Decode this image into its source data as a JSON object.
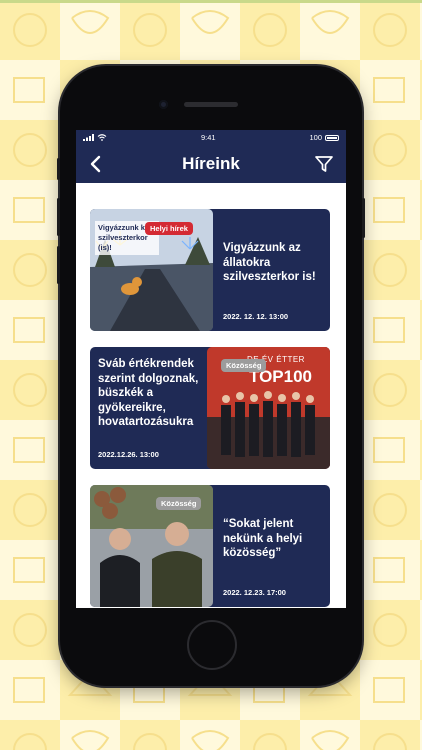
{
  "status_bar": {
    "time": "9:41",
    "battery": "100"
  },
  "header": {
    "title": "Híreink"
  },
  "news": [
    {
      "title": "Vigyázzunk az állatokra szilveszterkor is!",
      "date": "2022. 12. 12. 13:00",
      "category": "Helyi hírek",
      "image_caption": "Vigyázzunk k szilveszterkor (is)!"
    },
    {
      "title": "Sváb értékrendek szerint dolgoznak, büszkék a gyökereikre, hovatartozásukra",
      "date": "2022.12.26. 13:00",
      "category": "Közösség",
      "image_caption": "DE ÉV ÉTTER",
      "image_banner": "TOP100"
    },
    {
      "title": "“Sokat jelent nekünk a helyi közösség”",
      "date": "2022. 12.23. 17:00",
      "category": "Közösség"
    }
  ],
  "colors": {
    "navy": "#1f2a55",
    "badge_red": "#d42a33",
    "badge_gray": "#9c9c9c",
    "background": "#fdf3c4"
  },
  "icons": [
    "back-chevron-icon",
    "filter-icon",
    "wifi-icon",
    "signal-icon",
    "battery-icon"
  ]
}
